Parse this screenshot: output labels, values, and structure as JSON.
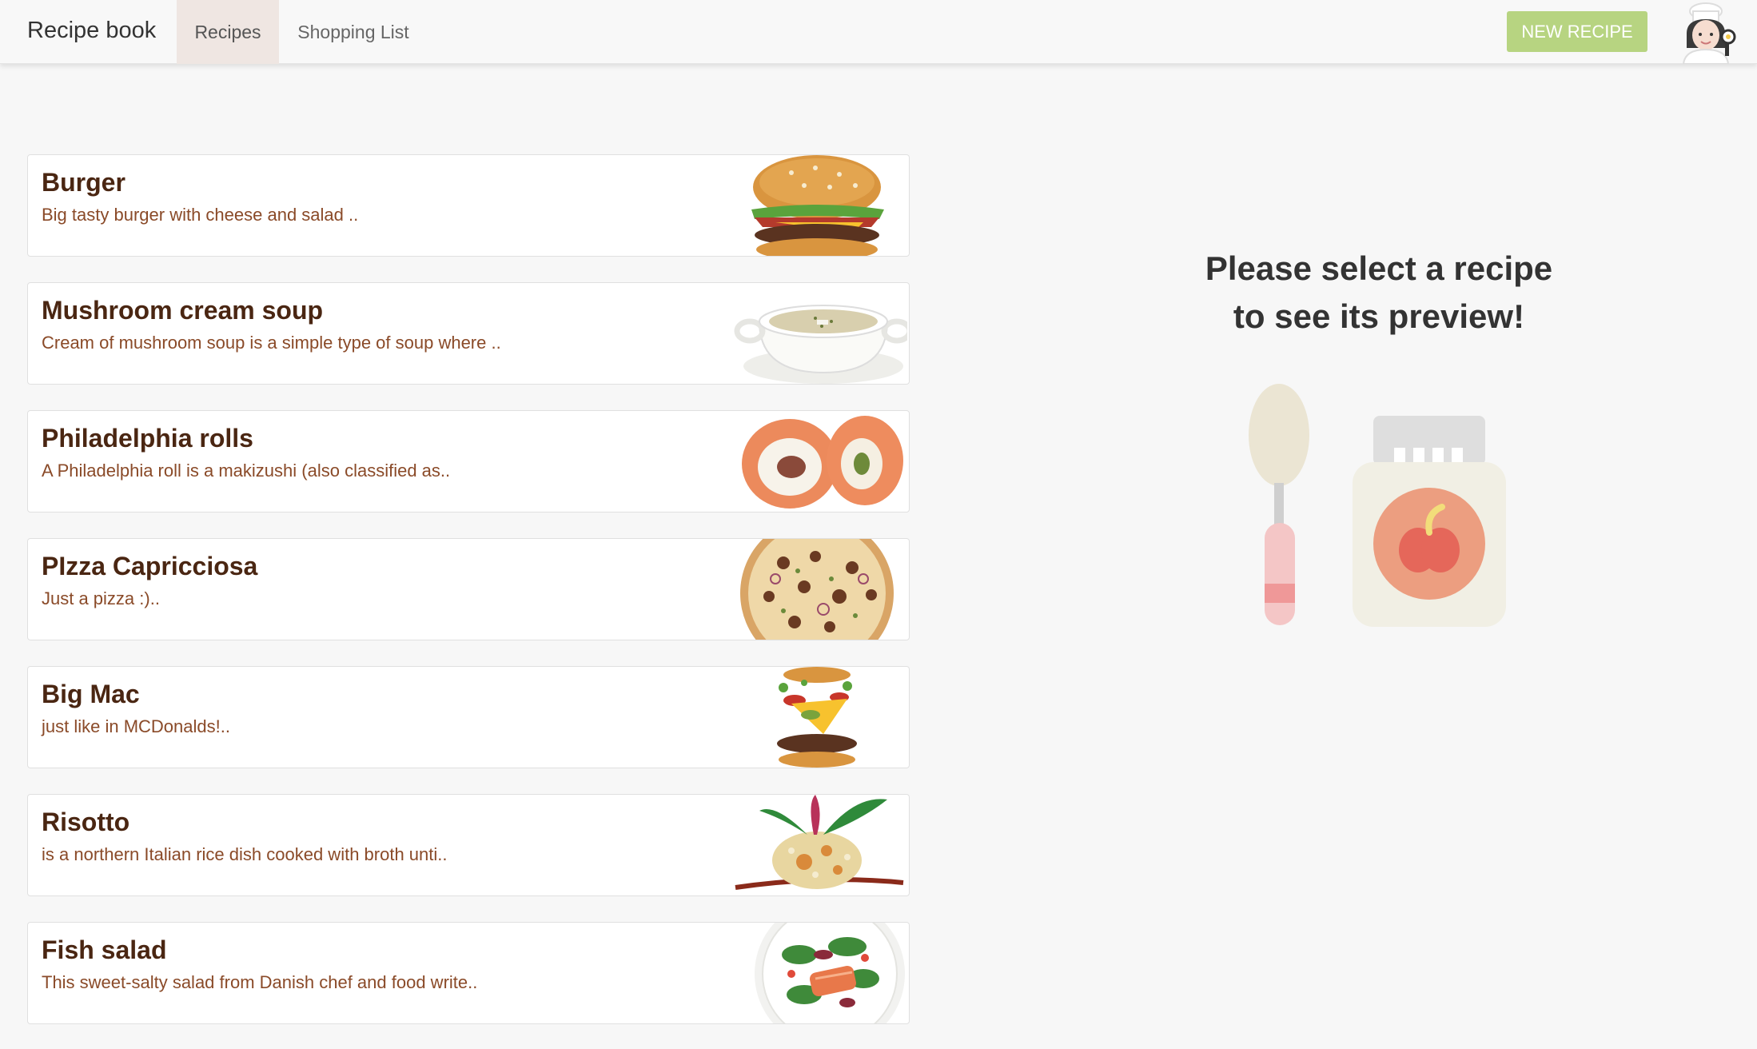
{
  "app": {
    "brand": "Recipe book",
    "tabs": [
      {
        "label": "Recipes",
        "active": true
      },
      {
        "label": "Shopping List",
        "active": false
      }
    ],
    "new_recipe_label": "NEW RECIPE",
    "avatar_icon": "chef-avatar-icon"
  },
  "recipes": [
    {
      "name": "Burger",
      "description": "Big tasty burger with cheese and salad ..",
      "image_icon": "burger-image"
    },
    {
      "name": "Mushroom cream soup",
      "description": "Cream of mushroom soup is a simple type of soup where ..",
      "image_icon": "soup-image"
    },
    {
      "name": "Philadelphia rolls",
      "description": "A Philadelphia roll is a makizushi (also classified as..",
      "image_icon": "sushi-rolls-image"
    },
    {
      "name": "PIzza Capricciosa",
      "description": "Just a pizza :)..",
      "image_icon": "pizza-image"
    },
    {
      "name": "Big Mac",
      "description": "just like in MCDonalds!..",
      "image_icon": "bigmac-image"
    },
    {
      "name": "Risotto",
      "description": "is a northern Italian rice dish cooked with broth unti..",
      "image_icon": "risotto-image"
    },
    {
      "name": "Fish salad",
      "description": "This sweet-salty salad from Danish chef and food write..",
      "image_icon": "fish-salad-image"
    }
  ],
  "preview": {
    "line1": "Please select a recipe",
    "line2": "to see its preview!",
    "illustration_icon": "spoon-and-jar-icon"
  },
  "colors": {
    "accent_button": "#b7d481",
    "title_text": "#4a2612",
    "desc_text": "#8a4a28",
    "active_tab_bg": "#efe6e2"
  }
}
